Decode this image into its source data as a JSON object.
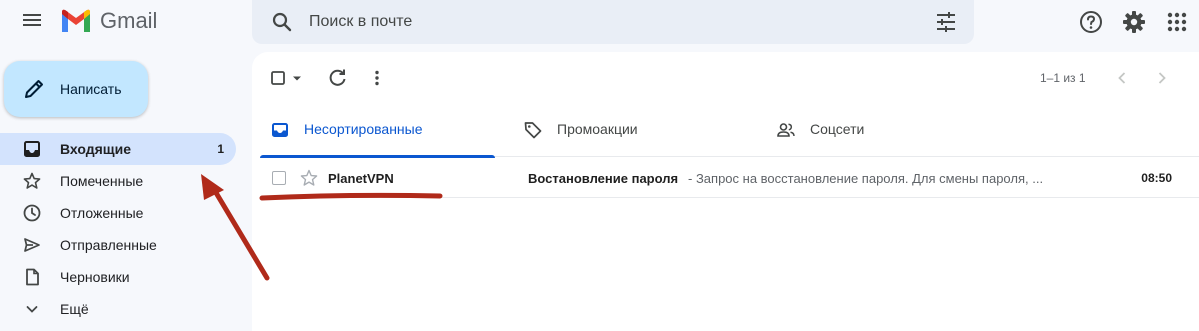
{
  "app": {
    "name": "Gmail"
  },
  "search": {
    "placeholder": "Поиск в почте"
  },
  "compose": {
    "label": "Написать"
  },
  "sidebar": {
    "items": [
      {
        "label": "Входящие",
        "count": "1",
        "icon": "inbox-icon",
        "active": true
      },
      {
        "label": "Помеченные",
        "icon": "star-icon"
      },
      {
        "label": "Отложенные",
        "icon": "clock-icon"
      },
      {
        "label": "Отправленные",
        "icon": "send-icon"
      },
      {
        "label": "Черновики",
        "icon": "draft-icon"
      },
      {
        "label": "Ещё",
        "icon": "chevron-down-icon"
      }
    ]
  },
  "toolbar": {
    "pager": "1–1 из 1"
  },
  "tabs": [
    {
      "label": "Несортированные",
      "icon": "inbox-icon",
      "active": true
    },
    {
      "label": "Промоакции",
      "icon": "tag-icon"
    },
    {
      "label": "Соцсети",
      "icon": "people-icon"
    }
  ],
  "emails": [
    {
      "sender": "PlanetVPN",
      "subject": "Востановление пароля",
      "snippet": " - Запрос на восстановление пароля. Для смены пароля, ...",
      "time": "08:50"
    }
  ],
  "colors": {
    "accent": "#0b57d0",
    "compose_bg": "#c2e7ff",
    "active_nav_bg": "#d3e3fd",
    "annotation": "#b02a1a"
  }
}
